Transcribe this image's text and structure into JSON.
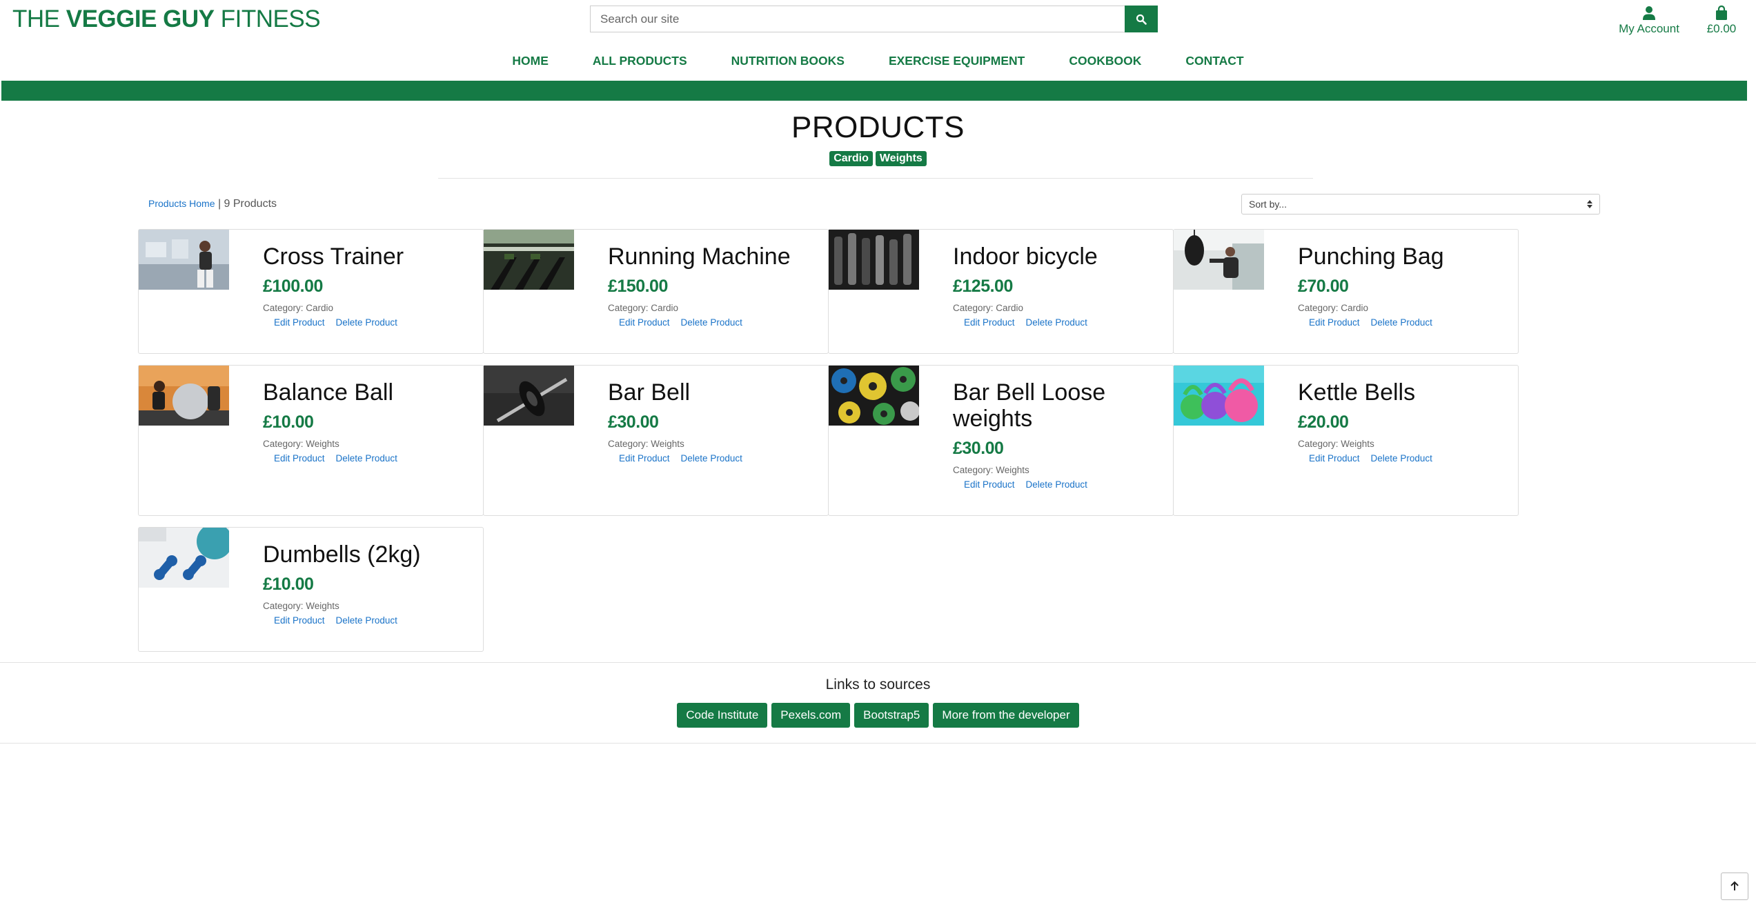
{
  "brand": {
    "prefix": "THE ",
    "bold": "VEGGIE GUY",
    "suffix": " FITNESS"
  },
  "search": {
    "placeholder": "Search our site",
    "icon": "search-icon"
  },
  "account": {
    "label": "My Account",
    "icon": "user-icon"
  },
  "bag": {
    "label": "£0.00",
    "icon": "shopping-bag-icon"
  },
  "nav": [
    "HOME",
    "ALL PRODUCTS",
    "NUTRITION BOOKS",
    "EXERCISE EQUIPMENT",
    "COOKBOOK",
    "CONTACT"
  ],
  "colors": {
    "accent": "#157a45",
    "link": "#1a73c8"
  },
  "page": {
    "title": "PRODUCTS",
    "categories": [
      "Cardio",
      "Weights"
    ],
    "breadcrumb_link": "Products Home",
    "product_count": "| 9 Products",
    "sort_label": "Sort by..."
  },
  "products": [
    {
      "name": "Cross Trainer",
      "price": "£100.00",
      "category": "Category: Cardio",
      "edit": "Edit Product",
      "delete": "Delete Product"
    },
    {
      "name": "Running Machine",
      "price": "£150.00",
      "category": "Category: Cardio",
      "edit": "Edit Product",
      "delete": "Delete Product"
    },
    {
      "name": "Indoor bicycle",
      "price": "£125.00",
      "category": "Category: Cardio",
      "edit": "Edit Product",
      "delete": "Delete Product"
    },
    {
      "name": "Punching Bag",
      "price": "£70.00",
      "category": "Category: Cardio",
      "edit": "Edit Product",
      "delete": "Delete Product"
    },
    {
      "name": "Balance Ball",
      "price": "£10.00",
      "category": "Category: Weights",
      "edit": "Edit Product",
      "delete": "Delete Product"
    },
    {
      "name": "Bar Bell",
      "price": "£30.00",
      "category": "Category: Weights",
      "edit": "Edit Product",
      "delete": "Delete Product"
    },
    {
      "name": "Bar Bell Loose weights",
      "price": "£30.00",
      "category": "Category: Weights",
      "edit": "Edit Product",
      "delete": "Delete Product"
    },
    {
      "name": "Kettle Bells",
      "price": "£20.00",
      "category": "Category: Weights",
      "edit": "Edit Product",
      "delete": "Delete Product"
    },
    {
      "name": "Dumbells (2kg)",
      "price": "£10.00",
      "category": "Category: Weights",
      "edit": "Edit Product",
      "delete": "Delete Product"
    }
  ],
  "footer": {
    "title": "Links to sources",
    "links": [
      "Code Institute",
      "Pexels.com",
      "Bootstrap5",
      "More from the developer"
    ]
  },
  "back_to_top": {
    "icon": "arrow-up-icon"
  }
}
